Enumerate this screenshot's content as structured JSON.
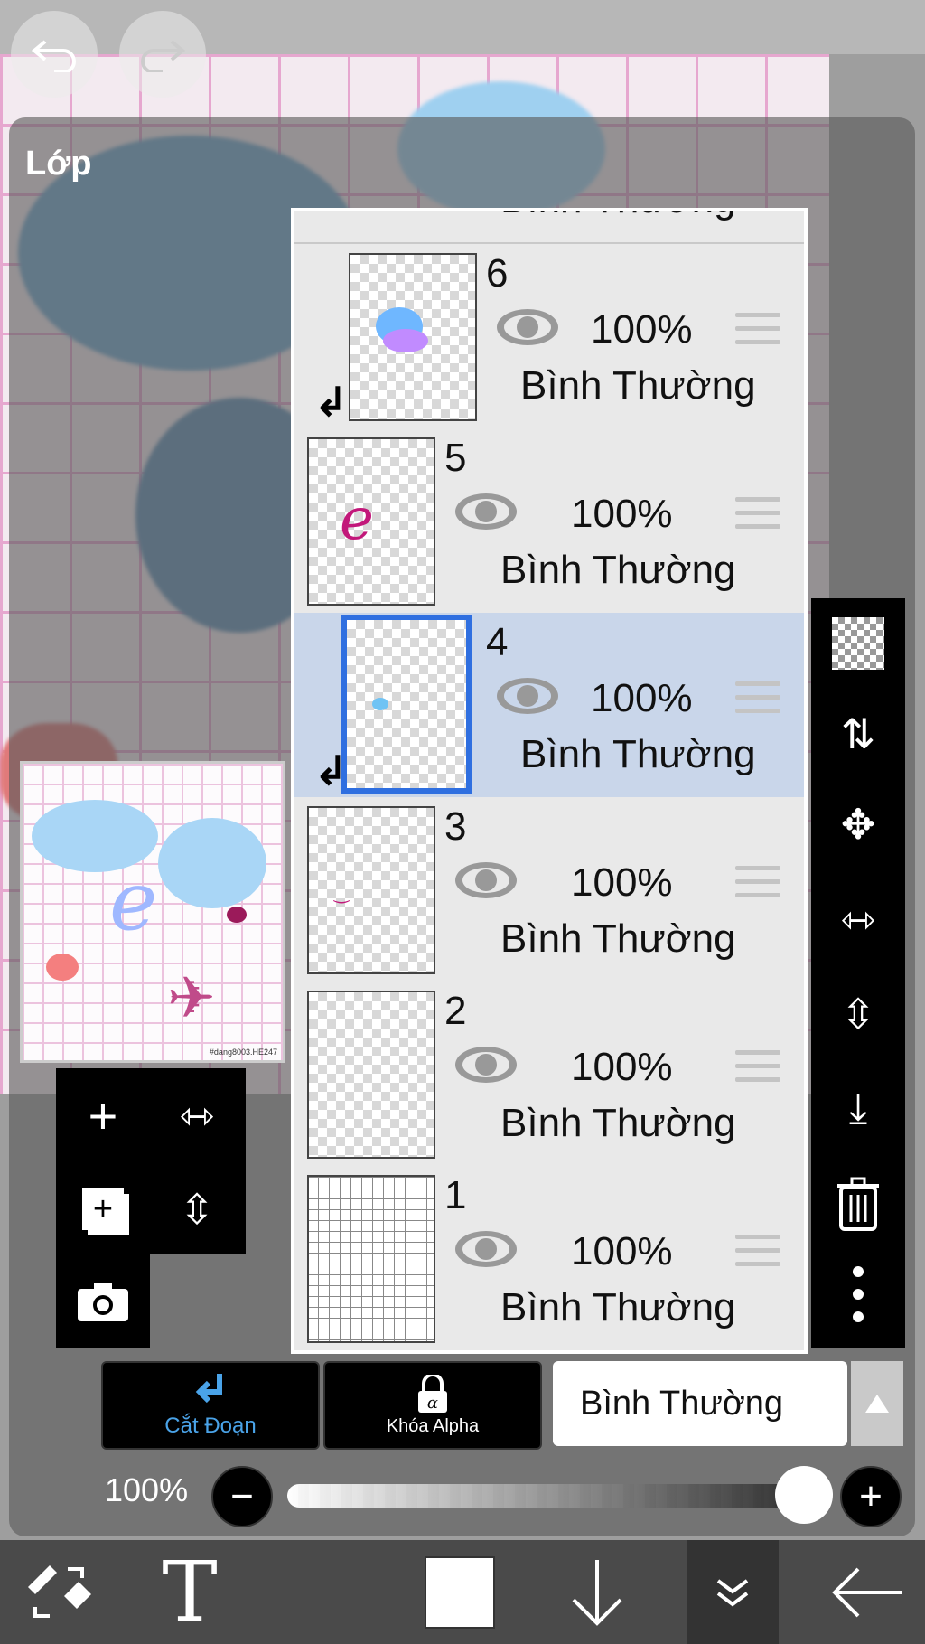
{
  "panel": {
    "title": "Lớp"
  },
  "layers": [
    {
      "number": "6",
      "visibility_icon": "eye-icon",
      "opacity": "100%",
      "blend": "Bình Thường",
      "clipped": true,
      "selected": false
    },
    {
      "number": "5",
      "visibility_icon": "eye-icon",
      "opacity": "100%",
      "blend": "Bình Thường",
      "clipped": false,
      "selected": false
    },
    {
      "number": "4",
      "visibility_icon": "eye-icon",
      "opacity": "100%",
      "blend": "Bình Thường",
      "clipped": true,
      "selected": true
    },
    {
      "number": "3",
      "visibility_icon": "eye-icon",
      "opacity": "100%",
      "blend": "Bình Thường",
      "clipped": false,
      "selected": false
    },
    {
      "number": "2",
      "visibility_icon": "eye-icon",
      "opacity": "100%",
      "blend": "Bình Thường",
      "clipped": false,
      "selected": false
    },
    {
      "number": "1",
      "visibility_icon": "eye-icon",
      "opacity": "100%",
      "blend": "Bình Thường",
      "clipped": false,
      "selected": false
    }
  ],
  "top_partial_layer": {
    "blend": "Bình Thường"
  },
  "mode_buttons": {
    "clipping": "Cắt Đoạn",
    "alpha_lock": "Khóa Alpha"
  },
  "blend_mode": {
    "selected": "Bình Thường"
  },
  "opacity": {
    "label": "100%",
    "value": 1.0
  },
  "preview": {
    "watermark": "#dang8003.HE247"
  },
  "colors": {
    "accent": "#2f6fe0",
    "clipping_active": "#4aa3e8",
    "selected_row": "#c9d6ea"
  },
  "right_toolbar_icons": [
    "checker-icon",
    "swap-layers-icon",
    "move-icon",
    "flip-horizontal-icon",
    "flip-vertical-icon",
    "merge-down-icon",
    "trash-icon",
    "more-icon"
  ],
  "left_tool_icons": [
    "add-layer-icon",
    "flip-h-icon",
    "duplicate-layer-icon",
    "flip-v-icon",
    "camera-icon"
  ],
  "bottom_bar_icons": [
    "tool-swap-icon",
    "text-icon",
    "color-icon",
    "down-arrow-icon",
    "layers-icon",
    "back-arrow-icon"
  ]
}
